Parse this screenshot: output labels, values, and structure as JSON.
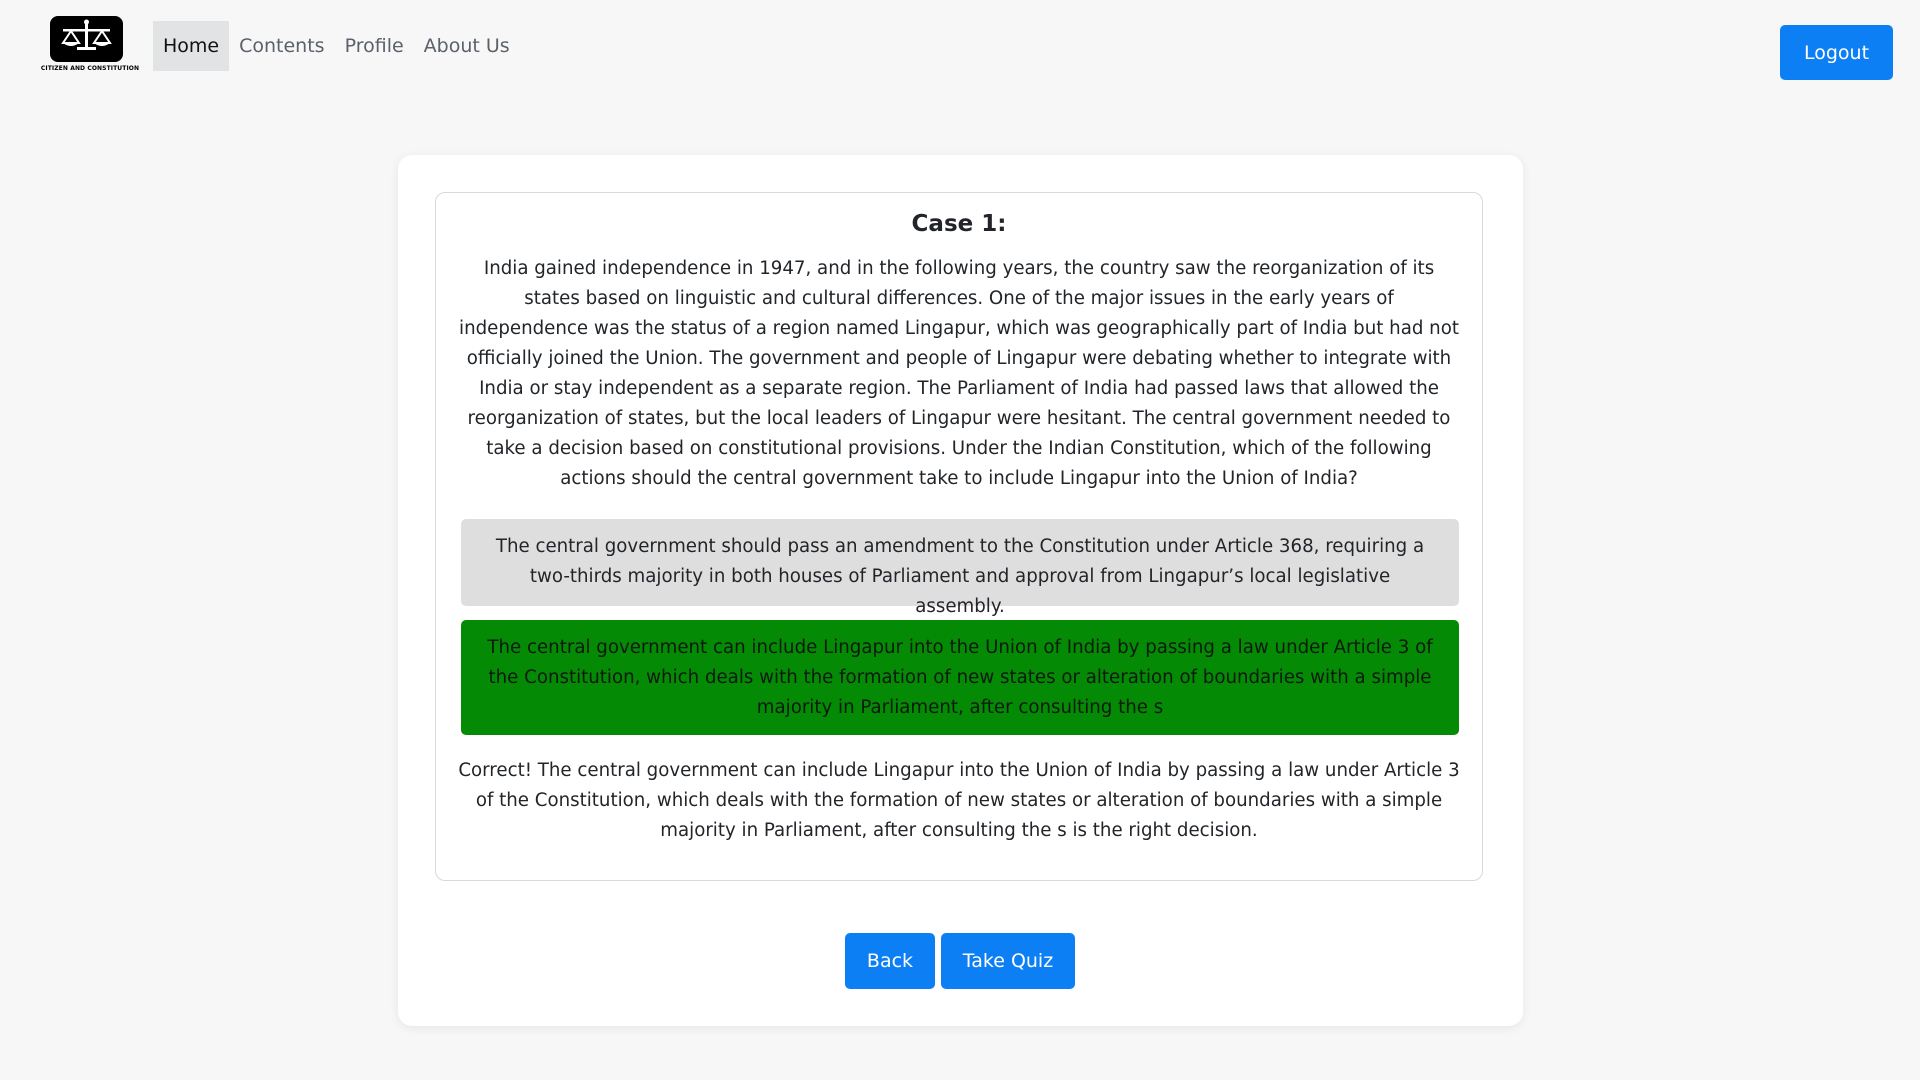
{
  "nav": {
    "logo_text": "CITIZEN AND CONSTITUTION",
    "links": [
      "Home",
      "Contents",
      "Profile",
      "About Us"
    ],
    "active": "Home",
    "logout_label": "Logout"
  },
  "case": {
    "title": "Case 1:",
    "text": "India gained independence in 1947, and in the following years, the country saw the reorganization of its states based on linguistic and cultural differences. One of the major issues in the early years of independence was the status of a region named Lingapur, which was geographically part of India but had not officially joined the Union. The government and people of Lingapur were debating whether to integrate with India or stay independent as a separate region. The Parliament of India had passed laws that allowed the reorganization of states, but the local leaders of Lingapur were hesitant. The central government needed to take a decision based on constitutional provisions. Under the Indian Constitution, which of the following actions should the central government take to include Lingapur into the Union of India?",
    "options": [
      "The central government should pass an amendment to the Constitution under Article 368, requiring a two-thirds majority in both houses of Parliament and approval from Lingapur’s local legislative assembly.",
      "The central government can include Lingapur into the Union of India by passing a law under Article 3 of the Constitution, which deals with the formation of new states or alteration of boundaries with a simple majority in Parliament, after consulting the s"
    ],
    "feedback": "Correct! The central government can include Lingapur into the Union of India by passing a law under Article 3 of the Constitution, which deals with the formation of new states or alteration of boundaries with a simple majority in Parliament, after consulting the s is the right decision."
  },
  "buttons": {
    "back_label": "Back",
    "quiz_label": "Take Quiz"
  },
  "colors": {
    "primary": "#0d7ff4",
    "correct": "#048a04",
    "option_neutral": "#dedede"
  },
  "icons": {
    "logo": "scales-of-justice-icon"
  }
}
